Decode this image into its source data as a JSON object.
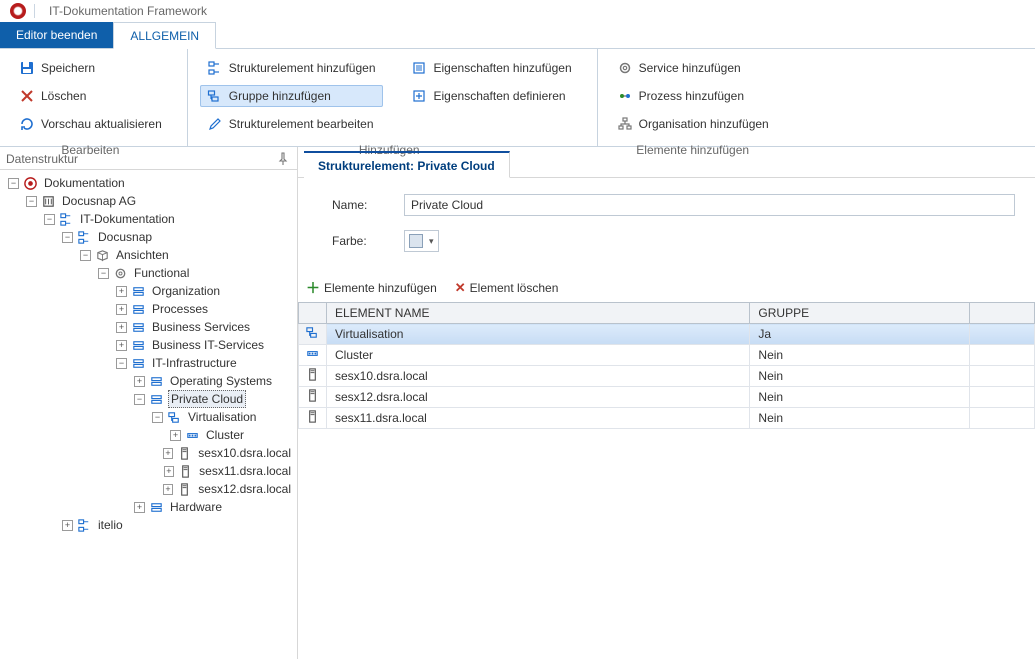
{
  "window": {
    "title": "IT-Dokumentation Framework"
  },
  "tabs": {
    "editor_beenden": "Editor beenden",
    "allgemein": "ALLGEMEIN"
  },
  "ribbon": {
    "bearbeiten": {
      "label": "Bearbeiten",
      "save": "Speichern",
      "delete": "Löschen",
      "preview": "Vorschau aktualisieren"
    },
    "hinzufuegen": {
      "label": "Hinzufügen",
      "struct_add": "Strukturelement hinzufügen",
      "group_add": "Gruppe hinzufügen",
      "struct_edit": "Strukturelement bearbeiten",
      "props_add": "Eigenschaften hinzufügen",
      "props_def": "Eigenschaften definieren"
    },
    "elemente": {
      "label": "Elemente hinzufügen",
      "service": "Service hinzufügen",
      "prozess": "Prozess hinzufügen",
      "org": "Organisation hinzufügen"
    }
  },
  "left_panel": {
    "title": "Datenstruktur"
  },
  "tree": {
    "n0": "Dokumentation",
    "n1": "Docusnap AG",
    "n2": "IT-Dokumentation",
    "n3": "Docusnap",
    "n4": "Ansichten",
    "n5": "Functional",
    "n6": "Organization",
    "n7": "Processes",
    "n8": "Business Services",
    "n9": "Business IT-Services",
    "n10": "IT-Infrastructure",
    "n11": "Operating Systems",
    "n12": "Private Cloud",
    "n13": "Virtualisation",
    "n14": "Cluster",
    "n15": "sesx10.dsra.local",
    "n16": "sesx11.dsra.local",
    "n17": "sesx12.dsra.local",
    "n18": "Hardware",
    "n19": "itelio"
  },
  "content": {
    "header": "Strukturelement: Private Cloud",
    "name_label": "Name:",
    "name_value": "Private Cloud",
    "color_label": "Farbe:"
  },
  "subtoolbar": {
    "add": "Elemente hinzufügen",
    "del": "Element löschen"
  },
  "grid": {
    "col_name": "ELEMENT NAME",
    "col_group": "GRUPPE",
    "rows": [
      {
        "name": "Virtualisation",
        "group": "Ja",
        "icon": "group",
        "selected": true
      },
      {
        "name": "Cluster",
        "group": "Nein",
        "icon": "cluster"
      },
      {
        "name": "sesx10.dsra.local",
        "group": "Nein",
        "icon": "server"
      },
      {
        "name": "sesx12.dsra.local",
        "group": "Nein",
        "icon": "server"
      },
      {
        "name": "sesx11.dsra.local",
        "group": "Nein",
        "icon": "server"
      }
    ]
  }
}
